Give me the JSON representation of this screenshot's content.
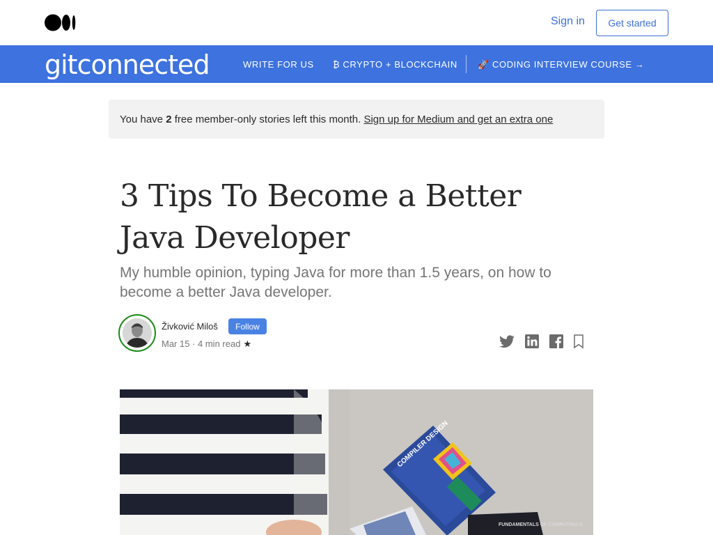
{
  "header": {
    "logo_icon": "medium-logo-icon",
    "sign_in": "Sign in",
    "get_started": "Get started"
  },
  "publication": {
    "name": "gitconnected",
    "bar_color": "#3d72df",
    "nav": [
      {
        "label": "WRITE FOR US"
      },
      {
        "label": "₿ CRYPTO + BLOCKCHAIN"
      },
      {
        "label": "🚀 CODING INTERVIEW COURSE →"
      }
    ]
  },
  "banner": {
    "prefix": "You have ",
    "count": "2",
    "suffix": " free member-only stories left this month. ",
    "link": "Sign up for Medium and get an extra one"
  },
  "article": {
    "title": "3 Tips To Become a Better Java Developer",
    "subtitle": "My humble opinion, typing Java for more than 1.5 years, on how to become a better Java developer.",
    "author": "Živković Miloš",
    "follow": "Follow",
    "meta": "Mar 15 · 4 min read",
    "star": "★"
  },
  "share": [
    "twitter-icon",
    "linkedin-icon",
    "facebook-icon",
    "bookmark-icon"
  ],
  "hero": {
    "book1_title": "COMPILER DESIGN",
    "book2_title": "FUNDAMENTALS OF COMPUTING II"
  },
  "colors": {
    "accent": "#3b6fd6",
    "follow_green": "#1a8917"
  }
}
